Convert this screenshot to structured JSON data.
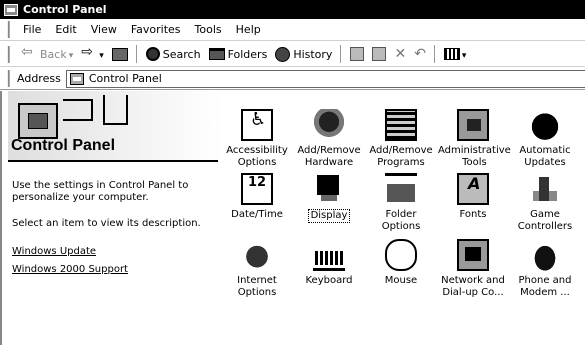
{
  "window": {
    "title": "Control Panel"
  },
  "menu": [
    "File",
    "Edit",
    "View",
    "Favorites",
    "Tools",
    "Help"
  ],
  "toolbar": {
    "back": "Back",
    "search": "Search",
    "folders": "Folders",
    "history": "History"
  },
  "address": {
    "label": "Address",
    "value": "Control Panel"
  },
  "leftpane": {
    "title": "Control Panel",
    "desc1": "Use the settings in Control Panel to personalize your computer.",
    "desc2": "Select an item to view its description.",
    "link1": "Windows Update",
    "link2": "Windows 2000 Support"
  },
  "items": [
    {
      "label": "Accessibility Options",
      "icon": "accessibility-icon"
    },
    {
      "label": "Add/Remove Hardware",
      "icon": "add-remove-hardware-icon"
    },
    {
      "label": "Add/Remove Programs",
      "icon": "add-remove-programs-icon"
    },
    {
      "label": "Administrative Tools",
      "icon": "administrative-tools-icon"
    },
    {
      "label": "Automatic Updates",
      "icon": "automatic-updates-icon"
    },
    {
      "label": "Date/Time",
      "icon": "date-time-icon"
    },
    {
      "label": "Display",
      "icon": "display-icon",
      "selected": true
    },
    {
      "label": "Folder Options",
      "icon": "folder-options-icon"
    },
    {
      "label": "Fonts",
      "icon": "fonts-icon"
    },
    {
      "label": "Game Controllers",
      "icon": "game-controllers-icon"
    },
    {
      "label": "Internet Options",
      "icon": "internet-options-icon"
    },
    {
      "label": "Keyboard",
      "icon": "keyboard-icon"
    },
    {
      "label": "Mouse",
      "icon": "mouse-icon"
    },
    {
      "label": "Network and Dial-up Co...",
      "icon": "network-icon"
    },
    {
      "label": "Phone and Modem ...",
      "icon": "phone-modem-icon"
    }
  ]
}
